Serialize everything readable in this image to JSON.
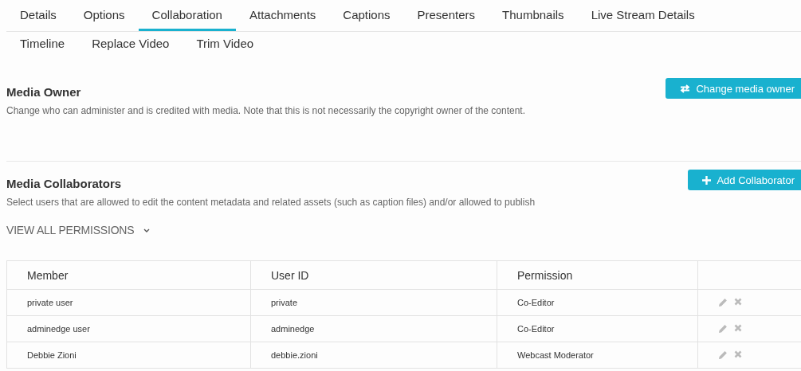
{
  "tabs": [
    {
      "label": "Details",
      "selected": false
    },
    {
      "label": "Options",
      "selected": false
    },
    {
      "label": "Collaboration",
      "selected": true
    },
    {
      "label": "Attachments",
      "selected": false
    },
    {
      "label": "Captions",
      "selected": false
    },
    {
      "label": "Presenters",
      "selected": false
    },
    {
      "label": "Thumbnails",
      "selected": false
    },
    {
      "label": "Live Stream Details",
      "selected": false
    },
    {
      "label": "Timeline",
      "selected": false
    },
    {
      "label": "Replace Video",
      "selected": false
    },
    {
      "label": "Trim Video",
      "selected": false
    }
  ],
  "media_owner": {
    "title": "Media Owner",
    "description": "Change who can administer and is credited with media. Note that this is not necessarily the copyright owner of the content.",
    "button": "Change media owner"
  },
  "media_collaborators": {
    "title": "Media Collaborators",
    "description": "Select users that are allowed to edit the content metadata and related assets (such as caption files) and/or allowed to publish",
    "button": "Add Collaborator",
    "permissions_toggle": "VIEW ALL PERMISSIONS",
    "table": {
      "columns": [
        "Member",
        "User ID",
        "Permission"
      ],
      "rows": [
        {
          "member": "private user",
          "user_id": "private",
          "permission": "Co-Editor"
        },
        {
          "member": "adminedge user",
          "user_id": "adminedge",
          "permission": "Co-Editor"
        },
        {
          "member": "Debbie Zioni",
          "user_id": "debbie.zioni",
          "permission": "Webcast Moderator"
        }
      ]
    }
  }
}
